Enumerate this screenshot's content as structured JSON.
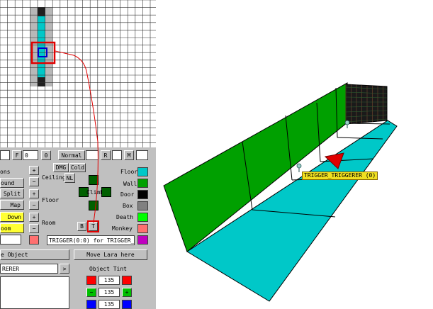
{
  "left_panel": {
    "row1": {
      "f_label": "F",
      "f_value": "0",
      "zero_label": "0",
      "normal_label": "Normal",
      "r_label": "R",
      "m_label": "M"
    },
    "tools": {
      "dmg_label": "DMG",
      "cold_label": "Cold",
      "ceiling_label": "Ceiling",
      "nl_label": "NL",
      "floor_label": "Floor",
      "climb_label": "Climb",
      "room_label": "Room",
      "b_label": "B",
      "t_label": "T"
    },
    "left_buttons": [
      "ons",
      "ound",
      "Split",
      "Map",
      "Down",
      "oom"
    ],
    "plus_label": "+",
    "minus_label": "−",
    "legend": [
      {
        "label": "Floor",
        "color": "#00c8c8"
      },
      {
        "label": "Wall",
        "color": "#00a000"
      },
      {
        "label": "Door",
        "color": "#000000"
      },
      {
        "label": "Box",
        "color": "#808080"
      },
      {
        "label": "Death",
        "color": "#00ff00"
      },
      {
        "label": "Monkey",
        "color": "#ff7070"
      }
    ],
    "trigger_field": "TRIGGER(0:0) for TRIGGER_",
    "object_button": "e Object",
    "move_lara_button": "Move Lara here",
    "object_field": "RERER",
    "arrow_label": ">",
    "object_tint_label": "Object Tint",
    "tint_values": [
      "135",
      "135",
      "135"
    ],
    "tint_minus": "−",
    "tint_plus": "+",
    "colors": {
      "red": "#ff0000",
      "green": "#00c000",
      "blue": "#0000ff",
      "cyan": "#00c8c8",
      "wall_green": "#00a000",
      "yellow": "#ffff33",
      "selection_red": "#e00000",
      "magenta": "#c000c0"
    }
  },
  "viewport": {
    "trigger_label": "TRIGGER_TRIGGERER (0)"
  }
}
